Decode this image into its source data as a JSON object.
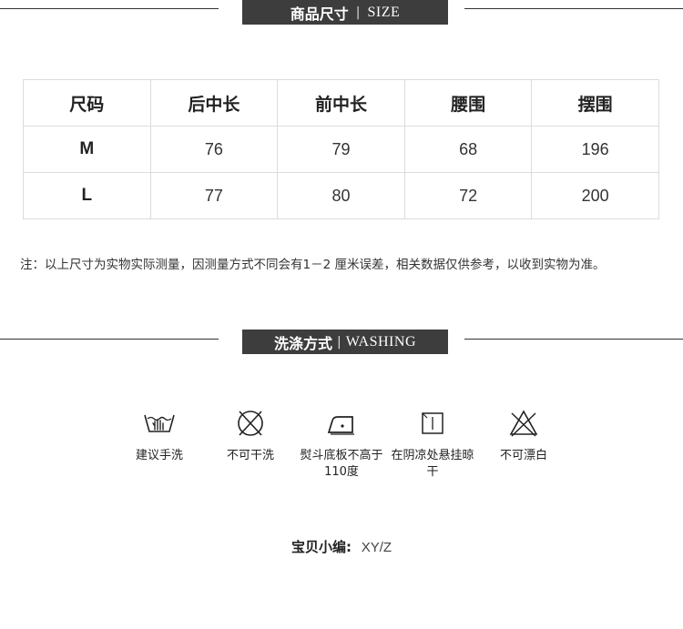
{
  "size_section": {
    "title_zh": "商品尺寸",
    "separator": "|",
    "title_en": "SIZE"
  },
  "size_table": {
    "headers": [
      "尺码",
      "后中长",
      "前中长",
      "腰围",
      "摆围"
    ],
    "rows": [
      [
        "M",
        "76",
        "79",
        "68",
        "196"
      ],
      [
        "L",
        "77",
        "80",
        "72",
        "200"
      ]
    ]
  },
  "note": "注：以上尺寸为实物实际测量，因测量方式不同会有1－2 厘米误差，相关数据仅供参考，以收到实物为准。",
  "washing_section": {
    "title_zh": "洗涤方式",
    "separator": "|",
    "title_en": "WASHING"
  },
  "wash_icons": [
    {
      "icon": "hand-wash-icon",
      "label": "建议手洗"
    },
    {
      "icon": "no-dry-clean-icon",
      "label": "不可干洗"
    },
    {
      "icon": "iron-icon",
      "label": "熨斗底板不高于110度"
    },
    {
      "icon": "shade-dry-icon",
      "label": "在阴凉处悬挂晾干"
    },
    {
      "icon": "no-bleach-icon",
      "label": "不可漂白"
    }
  ],
  "editor": {
    "label": "宝贝小编:",
    "value": "XY/Z"
  }
}
